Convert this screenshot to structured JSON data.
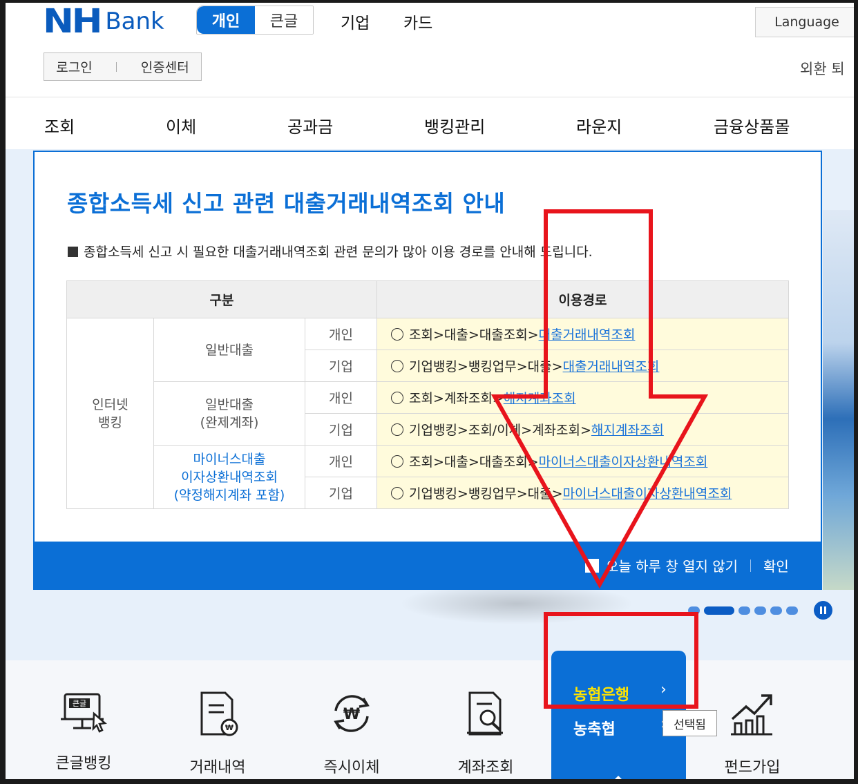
{
  "header": {
    "logo_nh": "NH",
    "logo_bank": "Bank",
    "segments": [
      "개인",
      "큰글"
    ],
    "links": [
      "기업",
      "카드"
    ],
    "language": "Language",
    "login": "로그인",
    "cert": "인증센터",
    "exchange": "외환  퇴"
  },
  "gnb": [
    "조회",
    "이체",
    "공과금",
    "뱅킹관리",
    "라운지",
    "금융상품몰"
  ],
  "popup": {
    "title": "종합소득세 신고 관련 대출거래내역조회 안내",
    "desc": "종합소득세 신고 시 필요한 대출거래내역조회 관련 문의가 많아 이용 경로를 안내해 드립니다.",
    "col_category": "구분",
    "col_path": "이용경로",
    "channel": "인터넷\n뱅킹",
    "groups": [
      {
        "name": "일반대출",
        "rows": [
          {
            "type": "개인",
            "path": "조회>대출>대출조회>",
            "link": "대출거래내역조회"
          },
          {
            "type": "기업",
            "path": "기업뱅킹>뱅킹업무>대출>",
            "link": "대출거래내역조회"
          }
        ]
      },
      {
        "name": "일반대출\n(완제계좌)",
        "rows": [
          {
            "type": "개인",
            "path": "조회>계좌조회>",
            "link": "해지계좌조회"
          },
          {
            "type": "기업",
            "path": "기업뱅킹>조회/이체>계좌조회>",
            "link": "해지계좌조회"
          }
        ]
      },
      {
        "name": "마이너스대출\n이자상환내역조회\n(약정해지계좌 포함)",
        "rows": [
          {
            "type": "개인",
            "path": "조회>대출>대출조회>",
            "link": "마이너스대출이자상환내역조회"
          },
          {
            "type": "기업",
            "path": "기업뱅킹>뱅킹업무>대출>",
            "link": "마이너스대출이자상환내역조회"
          }
        ]
      }
    ],
    "no_show_today": "오늘 하루 창 열지 않기",
    "confirm": "확인"
  },
  "quick_menu": [
    "큰글뱅킹",
    "거래내역",
    "즉시이체",
    "계좌조회",
    "펀드가입"
  ],
  "bank_select": {
    "option1": "농협은행",
    "option2": "농축협",
    "tooltip": "선택됨"
  },
  "colors": {
    "brand": "#0b6fd6",
    "annotation": "#e8141c",
    "highlight": "#ffe400"
  }
}
